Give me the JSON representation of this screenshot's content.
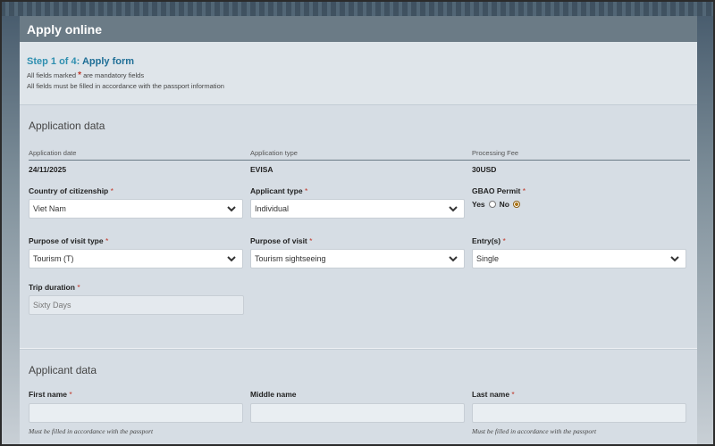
{
  "header": {
    "title": "Apply online"
  },
  "step": {
    "prefix": "Step 1 of 4:",
    "name": "Apply form"
  },
  "notes": {
    "mandatory_pre": "All fields marked",
    "mandatory_post": "are mandatory fields",
    "passport": "All fields must be filled in accordance with the passport information"
  },
  "application": {
    "section_title": "Application data",
    "meta": [
      {
        "label": "Application date",
        "value": "24/11/2025"
      },
      {
        "label": "Application type",
        "value": "EVISA"
      },
      {
        "label": "Processing Fee",
        "value": "30USD"
      }
    ],
    "country": {
      "label": "Country of citizenship",
      "value": "Viet Nam"
    },
    "applicant_type": {
      "label": "Applicant type",
      "value": "Individual"
    },
    "gbao": {
      "label": "GBAO Permit",
      "yes": "Yes",
      "no": "No",
      "selected": "No"
    },
    "purpose_type": {
      "label": "Purpose of visit type",
      "value": "Tourism (T)"
    },
    "purpose": {
      "label": "Purpose of visit",
      "value": "Tourism sightseeing"
    },
    "entries": {
      "label": "Entry(s)",
      "value": "Single"
    },
    "trip": {
      "label": "Trip duration",
      "placeholder": "Sixty Days"
    }
  },
  "applicant": {
    "section_title": "Applicant data",
    "first_name": {
      "label": "First name",
      "hint": "Must be filled in accordance with the passport"
    },
    "middle_name": {
      "label": "Middle name"
    },
    "last_name": {
      "label": "Last name",
      "hint": "Must be filled in accordance with the passport"
    }
  },
  "required_mark": "*"
}
